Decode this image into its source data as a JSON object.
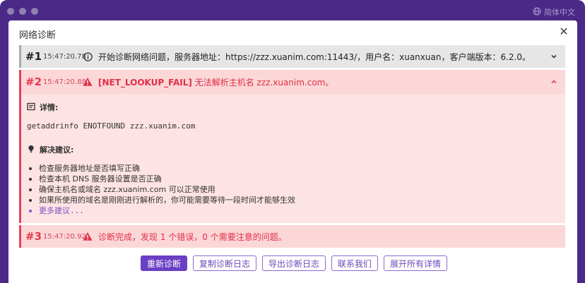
{
  "window": {
    "language_label": "简体中文"
  },
  "dialog": {
    "title": "网络诊断"
  },
  "entries": [
    {
      "num": "#1",
      "time": "15:47:20.78",
      "icon": "info-icon",
      "message": "开始诊断网络问题，服务器地址：https://zzz.xuanim.com:11443/，用户名：xuanxuan，客户端版本：6.2.0。",
      "expanded": false
    },
    {
      "num": "#2",
      "time": "15:47:20.88",
      "icon": "warning-icon",
      "code": "[NET_LOOKUP_FAIL]",
      "message": " 无法解析主机名 zzz.xuanim.com。",
      "expanded": true,
      "details_title": "详情:",
      "details_text": "getaddrinfo ENOTFOUND zzz.xuanim.com",
      "suggestions_title": "解决建议:",
      "suggestions": [
        "检查服务器地址是否填写正确",
        "检查本机 DNS 服务器设置是否正确",
        "确保主机名或域名 zzz.xuanim.com 可以正常使用",
        "如果所使用的域名是刚刚进行解析的，你可能需要等待一段时间才能够生效"
      ],
      "more_label": "更多建议..."
    },
    {
      "num": "#3",
      "time": "15:47:20.92",
      "icon": "warning-icon",
      "message": "诊断完成，发现 1 个错误，0 个需要注意的问题。",
      "expanded": false
    }
  ],
  "buttons": {
    "rediagnose": "重新诊断",
    "copy_log": "复制诊断日志",
    "export_log": "导出诊断日志",
    "contact": "联系我们",
    "expand_all": "展开所有详情"
  },
  "colors": {
    "accent": "#6a3fc4",
    "error": "#e02f47",
    "error_bg": "#fde3e3",
    "window_bg": "#4a2a86"
  }
}
